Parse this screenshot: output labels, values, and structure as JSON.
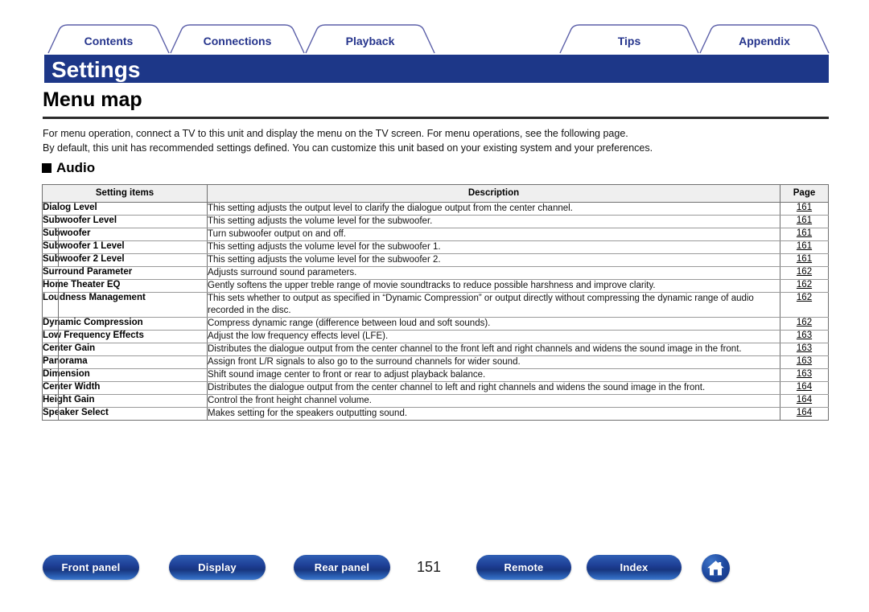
{
  "tabs": [
    {
      "label": "Contents",
      "active": false
    },
    {
      "label": "Connections",
      "active": false
    },
    {
      "label": "Playback",
      "active": false
    },
    {
      "label": "Tips",
      "active": false
    },
    {
      "label": "Appendix",
      "active": false
    }
  ],
  "header": {
    "title": "Settings",
    "accent_color": "#1d3788"
  },
  "page": {
    "heading": "Menu map",
    "intro_line_1": "For menu operation, connect a TV to this unit and display the menu on the TV screen. For menu operations, see the following page.",
    "intro_line_2": "By default, this unit has recommended settings defined. You can customize this unit based on your existing system and your preferences.",
    "section_heading": "Audio",
    "section_bullet": "filled-square-bullet"
  },
  "table": {
    "columns": [
      "Setting items",
      "Description",
      "Page"
    ],
    "rows": [
      {
        "item": "Dialog Level",
        "level": 1,
        "description": "This setting adjusts the output level to clarify the dialogue output from the center channel.",
        "page": "161"
      },
      {
        "item": "Subwoofer Level",
        "level": 1,
        "description": "This setting adjusts the volume level for the subwoofer.",
        "page": "161"
      },
      {
        "item": "Subwoofer",
        "level": 2,
        "description": "Turn subwoofer output on and off.",
        "page": "161"
      },
      {
        "item": "Subwoofer 1 Level",
        "level": 2,
        "description": "This setting adjusts the volume level for the subwoofer 1.",
        "page": "161"
      },
      {
        "item": "Subwoofer 2 Level",
        "level": 2,
        "description": "This setting adjusts the volume level for the subwoofer 2.",
        "page": "161"
      },
      {
        "item": "Surround Parameter",
        "level": 1,
        "description": "Adjusts surround sound parameters.",
        "page": "162"
      },
      {
        "item": "Home Theater EQ",
        "level": 2,
        "description": "Gently softens the upper treble range of movie soundtracks to reduce possible harshness and improve clarity.",
        "page": "162"
      },
      {
        "item": "Loudness Management",
        "level": 2,
        "description": "This sets whether to output as specified in “Dynamic Compression” or output directly without compressing the dynamic range of audio recorded in the disc.",
        "page": "162"
      },
      {
        "item": "Dynamic Compression",
        "level": 2,
        "description": "Compress dynamic range (difference between loud and soft sounds).",
        "page": "162"
      },
      {
        "item": "Low Frequency Effects",
        "level": 2,
        "description": "Adjust the low frequency effects level (LFE).",
        "page": "163"
      },
      {
        "item": "Center Gain",
        "level": 2,
        "description": "Distributes the dialogue output from the center channel to the front left and right channels and widens the sound image in the front.",
        "page": "163"
      },
      {
        "item": "Panorama",
        "level": 2,
        "description": "Assign front L/R signals to also go to the surround channels for wider sound.",
        "page": "163"
      },
      {
        "item": "Dimension",
        "level": 2,
        "description": "Shift sound image center to front or rear to adjust playback balance.",
        "page": "163"
      },
      {
        "item": "Center Width",
        "level": 2,
        "description": "Distributes the dialogue output from the center channel to left and right channels and widens the sound image in the front.",
        "page": "164"
      },
      {
        "item": "Height Gain",
        "level": 2,
        "description": "Control the front height channel volume.",
        "page": "164"
      },
      {
        "item": "Speaker Select",
        "level": 2,
        "description": "Makes setting for the speakers outputting sound.",
        "page": "164"
      }
    ]
  },
  "footer": {
    "buttons": [
      {
        "label": "Front panel"
      },
      {
        "label": "Display"
      },
      {
        "label": "Rear panel"
      },
      {
        "label": "Remote"
      },
      {
        "label": "Index"
      }
    ],
    "page_number": "151",
    "home_icon": "home-icon"
  }
}
